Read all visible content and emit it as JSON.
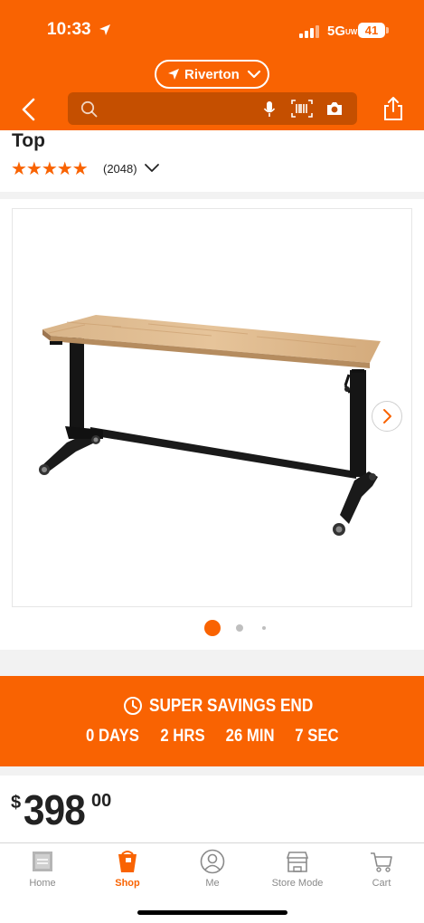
{
  "status_bar": {
    "time": "10:33",
    "network": "5G",
    "network_sub": "UW",
    "battery": "41"
  },
  "header": {
    "location": "Riverton",
    "search_placeholder": ""
  },
  "product": {
    "title_fragment": "Top",
    "stars": "★★★★★",
    "rating": 5,
    "review_count": "(2048)",
    "image_description": "height adjustable workbench"
  },
  "gallery": {
    "total_images": 3,
    "current_index": 0
  },
  "promo": {
    "title": "SUPER SAVINGS END",
    "days": "0 DAYS",
    "hours": "2 HRS",
    "minutes": "26 MIN",
    "seconds": "7 SEC"
  },
  "price": {
    "currency": "$",
    "dollars": "398",
    "cents": "00"
  },
  "tabs": [
    {
      "label": "Home",
      "icon": "home-depot-logo-icon",
      "active": false
    },
    {
      "label": "Shop",
      "icon": "shop-bucket-icon",
      "active": true
    },
    {
      "label": "Me",
      "icon": "person-icon",
      "active": false
    },
    {
      "label": "Store Mode",
      "icon": "store-icon",
      "active": false
    },
    {
      "label": "Cart",
      "icon": "cart-icon",
      "active": false
    }
  ],
  "colors": {
    "brand": "#f96302",
    "text": "#222222",
    "muted": "#8a8a8a"
  }
}
